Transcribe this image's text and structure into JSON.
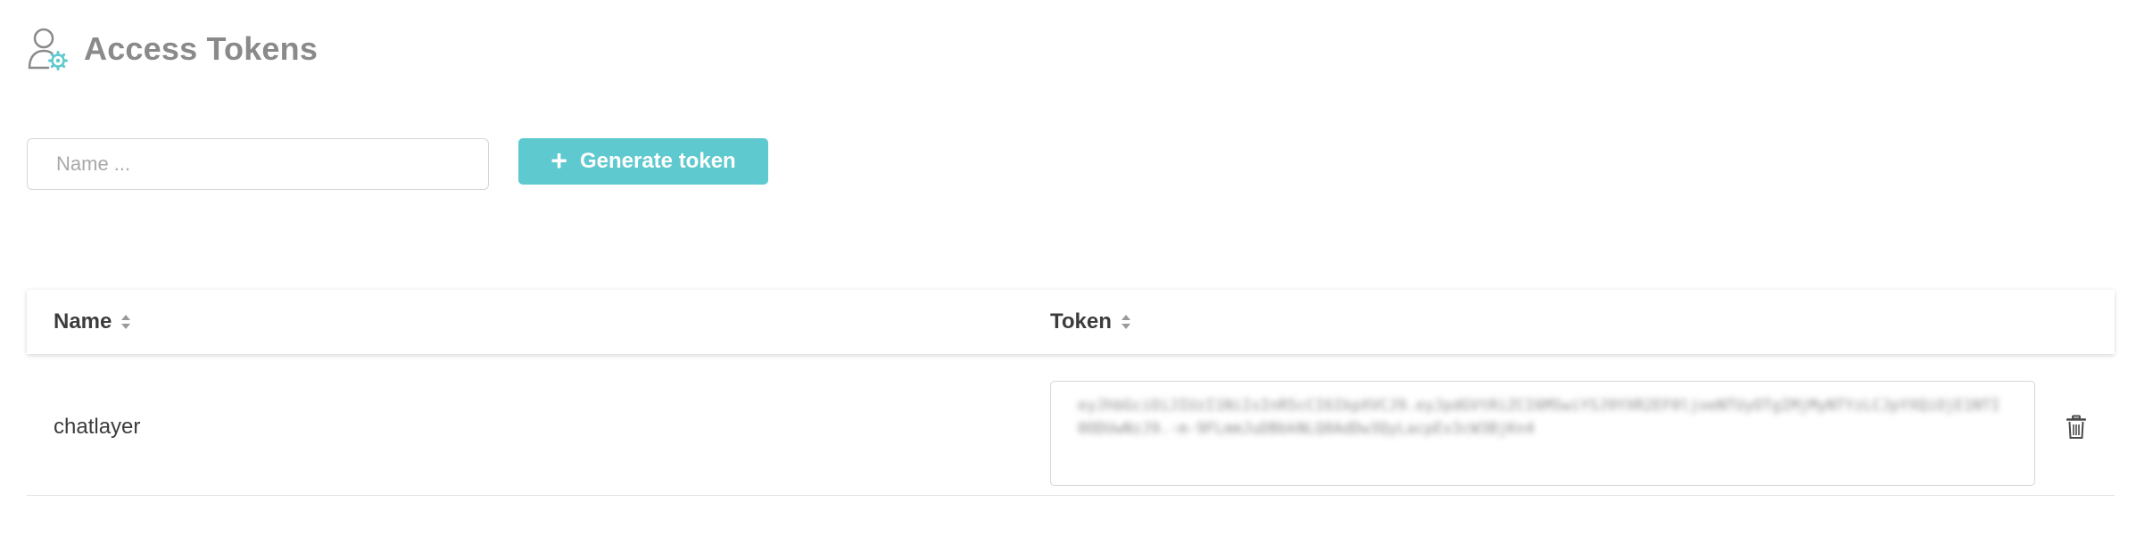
{
  "header": {
    "title": "Access Tokens",
    "icon": "user-settings-icon"
  },
  "toolbar": {
    "name_input": {
      "placeholder": "Name ...",
      "value": ""
    },
    "generate_button": {
      "icon": "plus-icon",
      "label": "Generate token"
    }
  },
  "table": {
    "columns": [
      {
        "label": "Name",
        "sortable": true
      },
      {
        "label": "Token",
        "sortable": true
      }
    ],
    "rows": [
      {
        "name": "chatlayer",
        "token": "eyJhbGciOiJIUzI1NiIsInR5cCI6IkpXVCJ9.eyJpdGVtRiZCI6MSwiYSJ9YXR2EF0ljoeNTUyOTgIMjMyNTYzLCJpYXQiOjE1NTI0ODUwNzJ9.-m-9FLmmJuDBbkNLQ8AdDw3QyLacpEx3cW3BjKn4",
        "actions": {
          "delete_icon": "trash-icon"
        }
      }
    ]
  },
  "colors": {
    "accent": "#5ec9cf",
    "title_gray": "#8a8a8a",
    "border": "#d6d6d6"
  }
}
